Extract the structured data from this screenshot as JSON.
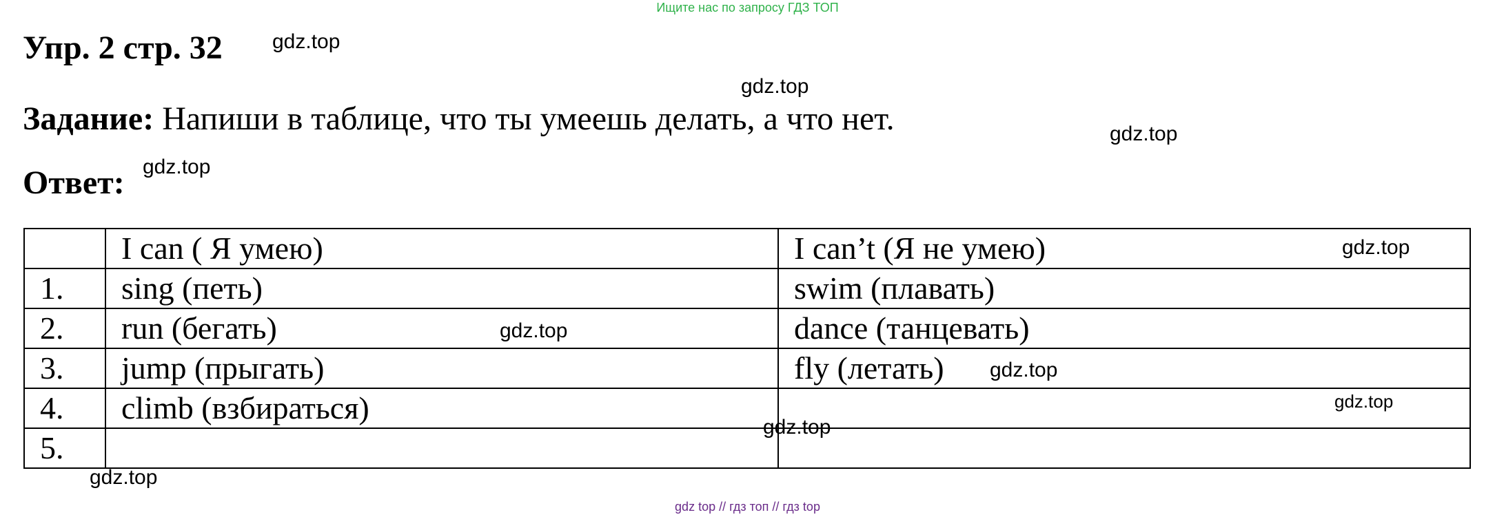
{
  "banner": "Ищите нас по запросу ГДЗ ТОП",
  "title": "Упр. 2 стр. 32",
  "task": {
    "label": "Задание:",
    "text": " Напиши в таблице, что ты умеешь делать, а что нет."
  },
  "answer_label": "Ответ:",
  "table": {
    "header": {
      "num": "",
      "can": "I can ( Я умею)",
      "cant": "I can’t (Я не умею)"
    },
    "rows": [
      {
        "num": "1.",
        "can": "sing (петь)",
        "cant": "swim (плавать)"
      },
      {
        "num": "2.",
        "can": "run (бегать)",
        "cant": "dance (танцевать)"
      },
      {
        "num": "3.",
        "can": "jump  (прыгать)",
        "cant": "fly (летать)"
      },
      {
        "num": "4.",
        "can": "climb (взбираться)",
        "cant": ""
      },
      {
        "num": "5.",
        "can": "",
        "cant": ""
      }
    ]
  },
  "watermarks": [
    "gdz.top",
    "gdz.top",
    "gdz.top",
    "gdz.top",
    "gdz.top",
    "gdz.top",
    "gdz.top",
    "gdz.top",
    "gdz.top",
    "gdz.top"
  ],
  "footer": "gdz top  //  гдз топ  //  гдз top"
}
